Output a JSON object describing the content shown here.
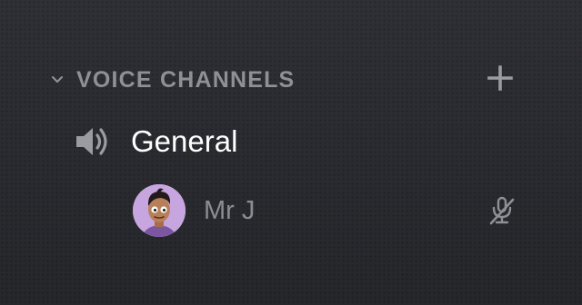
{
  "category": {
    "label": "VOICE CHANNELS",
    "collapse_icon": "chevron-down-icon",
    "add_icon": "plus-icon"
  },
  "channel": {
    "name": "General",
    "icon": "speaker-icon"
  },
  "members": [
    {
      "name": "Mr J",
      "avatar_icon": "avatar",
      "status_icon": "microphone-muted-icon"
    }
  ],
  "colors": {
    "background": "#2b2c31",
    "category_text": "#8e9097",
    "channel_text": "#ffffff",
    "member_text": "#8b8d93",
    "icon_gray": "#9a9ca2",
    "avatar_bg": "#c7a6df"
  }
}
